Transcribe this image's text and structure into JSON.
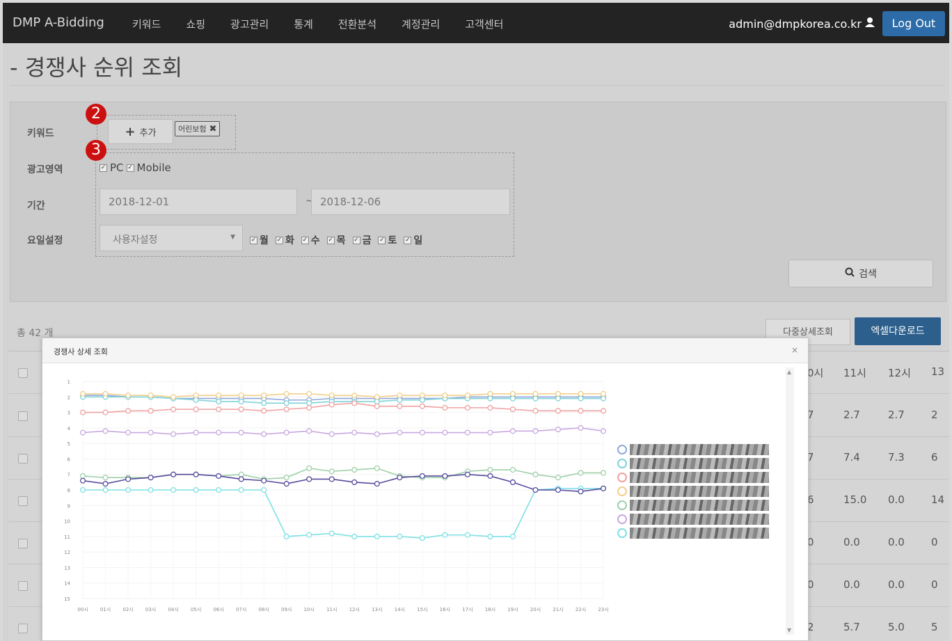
{
  "nav": {
    "brand": "DMP A-Bidding",
    "menu": [
      "키워드",
      "쇼핑",
      "광고관리",
      "통계",
      "전환분석",
      "계정관리",
      "고객센터"
    ],
    "user_email": "admin@dmpkorea.co.kr",
    "logout_label": "Log Out"
  },
  "page": {
    "title": "- 경쟁사 순위 조회"
  },
  "filters": {
    "keyword_label": "키워드",
    "add_label": "추가",
    "keyword_tag": "어린보험",
    "area_label": "광고영역",
    "area_pc": "PC",
    "area_mobile": "Mobile",
    "period_label": "기간",
    "date_start": "2018-12-01",
    "date_sep": "~",
    "date_end": "2018-12-06",
    "weekday_label": "요일설정",
    "weekday_select": "사용자설정",
    "days": [
      "월",
      "화",
      "수",
      "목",
      "금",
      "토",
      "일"
    ],
    "search_label": "검색",
    "badge2": "2",
    "badge3": "3"
  },
  "results": {
    "count_label": "총 42 개",
    "multi_detail_label": "다중상세조회",
    "excel_label": "엑셀다운로드",
    "col_headers": [
      "0시",
      "11시",
      "12시",
      "13"
    ],
    "rows": [
      [
        "7",
        "2.7",
        "2.7",
        "2"
      ],
      [
        "7",
        "7.4",
        "7.3",
        "6"
      ],
      [
        "6",
        "15.0",
        "0.0",
        "14"
      ],
      [
        "0",
        "0.0",
        "0.0",
        "0"
      ],
      [
        "0",
        "0.0",
        "0.0",
        "0"
      ],
      [
        "2",
        "5.7",
        "5.0",
        "5"
      ]
    ]
  },
  "modal": {
    "title": "경쟁사 상세 조회",
    "close": "×"
  },
  "chart_data": {
    "type": "line",
    "x": [
      "00시",
      "01시",
      "02시",
      "03시",
      "04시",
      "05시",
      "06시",
      "07시",
      "08시",
      "09시",
      "10시",
      "11시",
      "12시",
      "13시",
      "14시",
      "15시",
      "16시",
      "17시",
      "18시",
      "19시",
      "20시",
      "21시",
      "22시",
      "23시"
    ],
    "ylim": [
      1,
      15
    ],
    "y_ticks": [
      1,
      2,
      3,
      4,
      5,
      6,
      7,
      8,
      9,
      10,
      11,
      12,
      13,
      14,
      15
    ],
    "y_inverted": true,
    "legend_position": "right",
    "series": [
      {
        "color": "#8fa8d8",
        "values": [
          1.9,
          1.9,
          2.0,
          2.0,
          2.1,
          2.1,
          2.1,
          2.1,
          2.1,
          2.2,
          2.2,
          2.1,
          2.1,
          2.1,
          2.1,
          2.1,
          2.1,
          2.0,
          2.0,
          2.0,
          2.0,
          2.0,
          2.0,
          2.0
        ]
      },
      {
        "color": "#7dd3d9",
        "values": [
          2.0,
          2.0,
          2.0,
          2.0,
          2.1,
          2.2,
          2.3,
          2.3,
          2.4,
          2.4,
          2.4,
          2.3,
          2.3,
          2.3,
          2.2,
          2.2,
          2.1,
          2.1,
          2.1,
          2.1,
          2.1,
          2.1,
          2.1,
          2.1
        ]
      },
      {
        "color": "#f0a0a0",
        "values": [
          3.0,
          3.0,
          2.9,
          2.9,
          2.8,
          2.8,
          2.8,
          2.8,
          2.9,
          2.8,
          2.7,
          2.5,
          2.4,
          2.6,
          2.6,
          2.6,
          2.7,
          2.7,
          2.7,
          2.8,
          2.9,
          2.9,
          2.9,
          2.9
        ]
      },
      {
        "color": "#f2cf8a",
        "values": [
          1.8,
          1.8,
          1.9,
          1.9,
          2.0,
          1.9,
          1.9,
          1.9,
          1.9,
          1.8,
          1.8,
          1.9,
          1.9,
          2.0,
          1.9,
          1.9,
          1.9,
          1.9,
          1.8,
          1.8,
          1.8,
          1.8,
          1.8,
          1.8
        ]
      },
      {
        "color": "#9ed0a8",
        "values": [
          7.1,
          7.2,
          7.2,
          7.2,
          7.0,
          7.0,
          7.1,
          7.0,
          7.3,
          7.2,
          6.6,
          6.8,
          6.7,
          6.6,
          7.1,
          7.2,
          7.2,
          6.8,
          6.7,
          6.7,
          7.0,
          7.2,
          6.9,
          6.9
        ]
      },
      {
        "color": "#c9a8e0",
        "values": [
          4.3,
          4.2,
          4.3,
          4.3,
          4.4,
          4.3,
          4.3,
          4.3,
          4.4,
          4.3,
          4.2,
          4.4,
          4.3,
          4.4,
          4.3,
          4.3,
          4.3,
          4.3,
          4.3,
          4.2,
          4.2,
          4.1,
          4.0,
          4.2
        ]
      },
      {
        "color": "#7de0e6",
        "values": [
          8.0,
          8.0,
          8.0,
          8.0,
          8.0,
          8.0,
          8.0,
          8.0,
          8.0,
          11.0,
          10.9,
          10.8,
          11.0,
          11.0,
          11.0,
          11.1,
          10.9,
          10.9,
          11.0,
          11.0,
          8.0,
          7.9,
          7.9,
          7.9
        ]
      },
      {
        "color": "#554a9c",
        "values": [
          7.4,
          7.6,
          7.3,
          7.2,
          7.0,
          7.0,
          7.1,
          7.3,
          7.4,
          7.6,
          7.3,
          7.3,
          7.5,
          7.6,
          7.2,
          7.1,
          7.1,
          7.0,
          7.1,
          7.5,
          8.0,
          8.0,
          8.1,
          7.9
        ]
      }
    ]
  }
}
